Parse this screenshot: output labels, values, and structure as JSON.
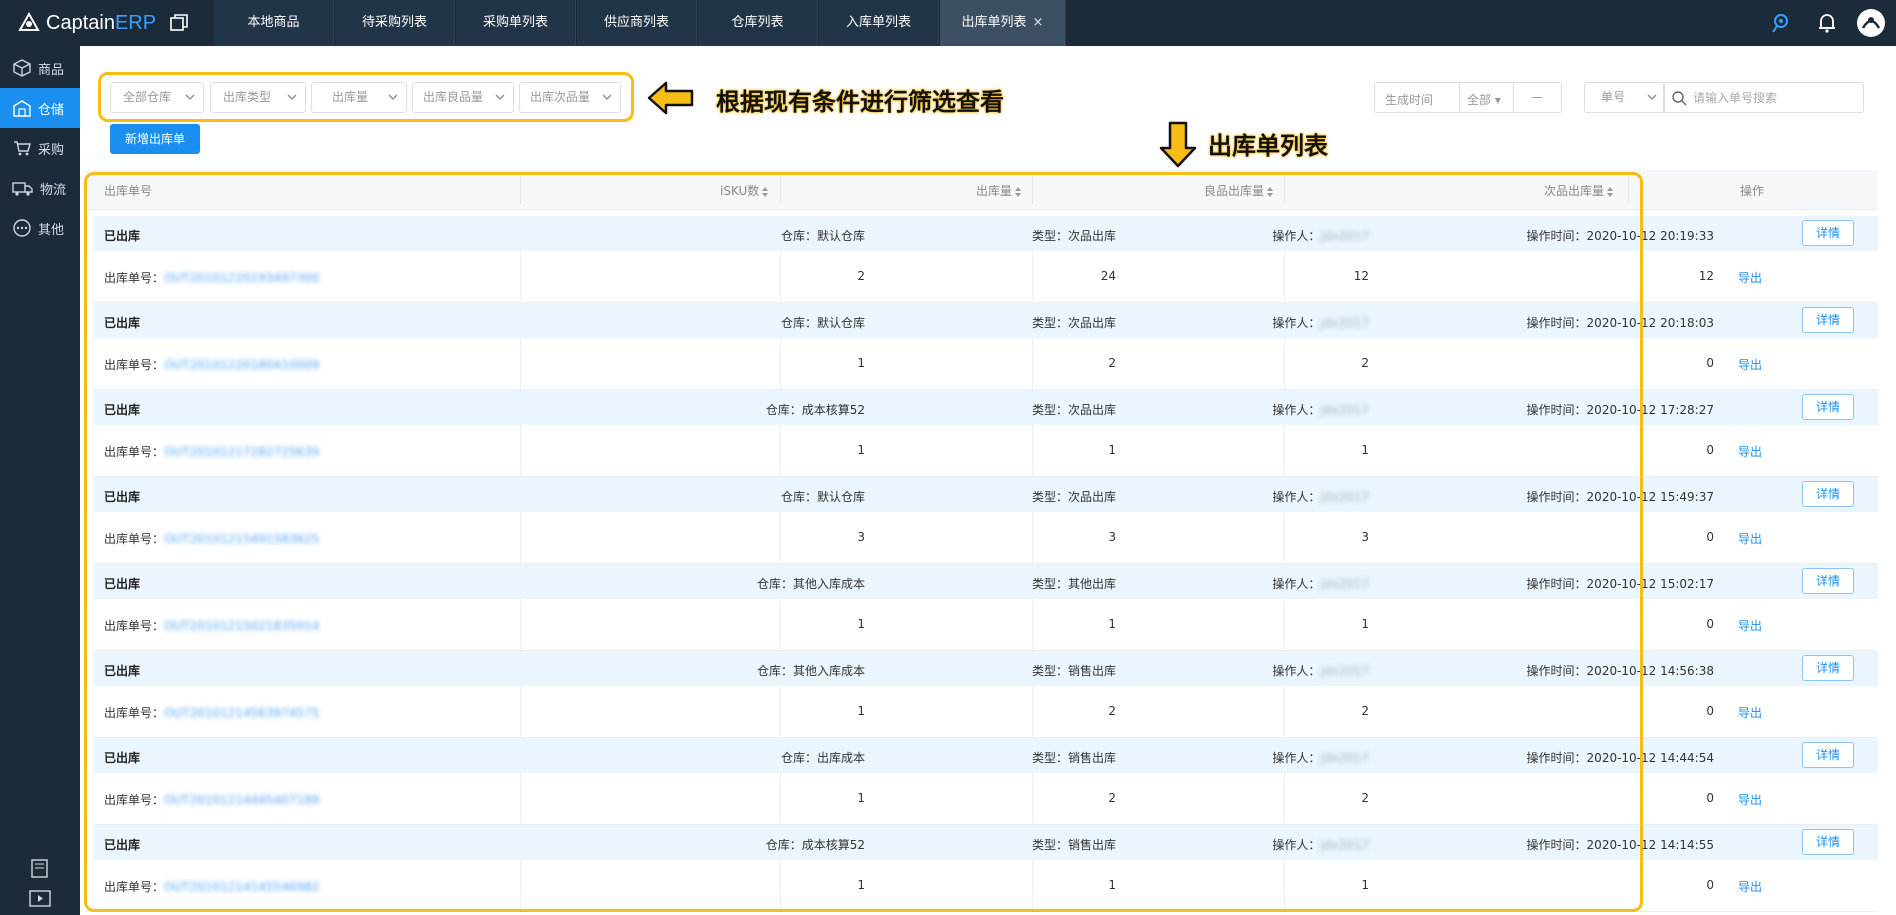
{
  "app": {
    "logo_main": "Captain",
    "logo_accent": "ERP"
  },
  "nav_tabs": [
    {
      "label": "本地商品"
    },
    {
      "label": "待采购列表"
    },
    {
      "label": "采购单列表"
    },
    {
      "label": "供应商列表"
    },
    {
      "label": "仓库列表"
    },
    {
      "label": "入库单列表"
    },
    {
      "label": "出库单列表",
      "close": "×"
    }
  ],
  "sidebar": {
    "items": [
      {
        "label": "商品",
        "icon": "box-icon"
      },
      {
        "label": "仓储",
        "icon": "warehouse-icon"
      },
      {
        "label": "采购",
        "icon": "cart-icon"
      },
      {
        "label": "物流",
        "icon": "truck-icon"
      },
      {
        "label": "其他",
        "icon": "more-icon"
      }
    ]
  },
  "filters": {
    "warehouse": "全部仓库",
    "out_type": "出库类型",
    "out_qty": "出库量",
    "good_qty": "出库良品量",
    "defect_qty": "出库次品量",
    "date_label": "生成时间",
    "date_range": "全部",
    "date_dash": "—",
    "search_field": "单号",
    "search_placeholder": "请输入单号搜索"
  },
  "annotations": {
    "filter_hint": "根据现有条件进行筛选查看",
    "list_hint": "出库单列表"
  },
  "add_button": "新增出库单",
  "table": {
    "headers": {
      "order_no": "出库单号",
      "sku_count": "iSKU数",
      "out_qty": "出库量",
      "good_qty": "良品出库量",
      "defect_qty": "次品出库量",
      "ops": "操作"
    },
    "detail_label": "详情",
    "export_label": "导出",
    "order_prefix": "出库单号：",
    "rows": [
      {
        "status": "已出库",
        "warehouse": "仓库：默认仓库",
        "type": "类型：次品出库",
        "operator": "操作人：",
        "operator_name": "jdx2017",
        "time": "操作时间：2020-10-12 20:19:33",
        "order_no": "OUT20101220193497300",
        "sku": "2",
        "qty": "24",
        "good": "12",
        "defect": "12"
      },
      {
        "status": "已出库",
        "warehouse": "仓库：默认仓库",
        "type": "类型：次品出库",
        "operator": "操作人：",
        "operator_name": "jdx2017",
        "time": "操作时间：2020-10-12 20:18:03",
        "order_no": "OUT20101220180410009",
        "sku": "1",
        "qty": "2",
        "good": "2",
        "defect": "0"
      },
      {
        "status": "已出库",
        "warehouse": "仓库：成本核算52",
        "type": "类型：次品出库",
        "operator": "操作人：",
        "operator_name": "jdx2017",
        "time": "操作时间：2020-10-12 17:28:27",
        "order_no": "OUT20101217282725639",
        "sku": "1",
        "qty": "1",
        "good": "1",
        "defect": "0"
      },
      {
        "status": "已出库",
        "warehouse": "仓库：默认仓库",
        "type": "类型：次品出库",
        "operator": "操作人：",
        "operator_name": "jdx2017",
        "time": "操作时间：2020-10-12 15:49:37",
        "order_no": "OUT20101215491583625",
        "sku": "3",
        "qty": "3",
        "good": "3",
        "defect": "0"
      },
      {
        "status": "已出库",
        "warehouse": "仓库：其他入库成本",
        "type": "类型：其他出库",
        "operator": "操作人：",
        "operator_name": "jdx2017",
        "time": "操作时间：2020-10-12 15:02:17",
        "order_no": "OUT20101215021835914",
        "sku": "1",
        "qty": "1",
        "good": "1",
        "defect": "0"
      },
      {
        "status": "已出库",
        "warehouse": "仓库：其他入库成本",
        "type": "类型：销售出库",
        "operator": "操作人：",
        "operator_name": "jdx2017",
        "time": "操作时间：2020-10-12 14:56:38",
        "order_no": "OUT20101214563974575",
        "sku": "1",
        "qty": "2",
        "good": "2",
        "defect": "0"
      },
      {
        "status": "已出库",
        "warehouse": "仓库：出库成本",
        "type": "类型：销售出库",
        "operator": "操作人：",
        "operator_name": "jdx2017",
        "time": "操作时间：2020-10-12 14:44:54",
        "order_no": "OUT20101214445407189",
        "sku": "1",
        "qty": "2",
        "good": "2",
        "defect": "0"
      },
      {
        "status": "已出库",
        "warehouse": "仓库：成本核算52",
        "type": "类型：销售出库",
        "operator": "操作人：",
        "operator_name": "jdx2017",
        "time": "操作时间：2020-10-12 14:14:55",
        "order_no": "OUT20101214145546982",
        "sku": "1",
        "qty": "1",
        "good": "1",
        "defect": "0"
      }
    ]
  }
}
